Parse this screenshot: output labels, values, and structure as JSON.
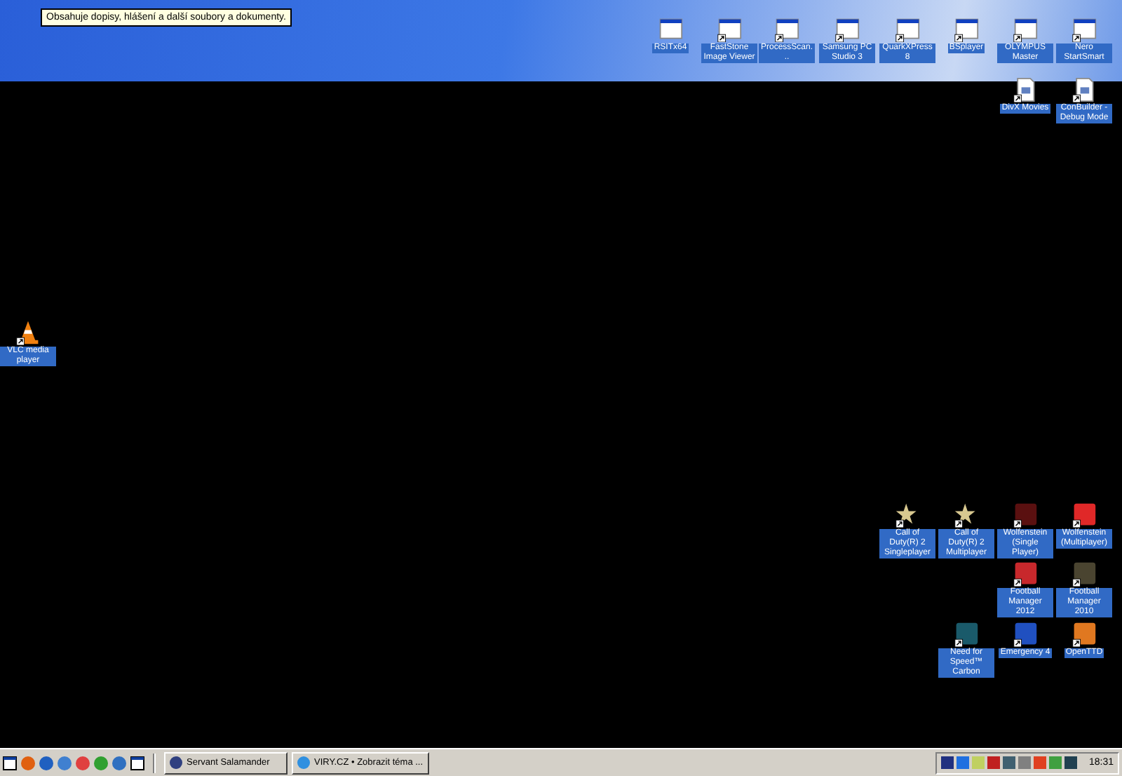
{
  "tooltip": {
    "text": "Obsahuje dopisy, hlášení a další soubory a dokumenty."
  },
  "desktop_icons": [
    {
      "label": "RSITx64",
      "kind": "window",
      "shortcut": false
    },
    {
      "label": "FastStone Image Viewer",
      "kind": "window",
      "shortcut": true
    },
    {
      "label": "ProcessScan...",
      "kind": "window",
      "shortcut": true
    },
    {
      "label": "Samsung PC Studio 3",
      "kind": "window",
      "shortcut": true
    },
    {
      "label": "QuarkXPress 8",
      "kind": "window",
      "shortcut": true
    },
    {
      "label": "BSplayer",
      "kind": "window",
      "shortcut": true
    },
    {
      "label": "OLYMPUS Master",
      "kind": "window",
      "shortcut": true
    },
    {
      "label": "Nero StartSmart",
      "kind": "window",
      "shortcut": true
    },
    {
      "label": "DivX Movies",
      "kind": "document",
      "shortcut": true
    },
    {
      "label": "ConBuilder -Debug Mode",
      "kind": "document",
      "shortcut": true
    },
    {
      "label": "VLC media player",
      "kind": "cone",
      "shortcut": true
    },
    {
      "label": "Call of Duty(R) 2 Singleplayer",
      "kind": "star",
      "shortcut": true
    },
    {
      "label": "Call of Duty(R) 2 Multiplayer",
      "kind": "star",
      "shortcut": true
    },
    {
      "label": "Wolfenstein (Single Player)",
      "kind": "tile",
      "color": "#5a1010",
      "shortcut": true
    },
    {
      "label": "Wolfenstein (Multiplayer)",
      "kind": "tile",
      "color": "#e02828",
      "shortcut": true
    },
    {
      "label": "Football Manager 2012",
      "kind": "tile",
      "color": "#c8282c",
      "shortcut": true
    },
    {
      "label": "Football Manager 2010",
      "kind": "tile",
      "color": "#4a4430",
      "shortcut": true
    },
    {
      "label": "Need for Speed™ Carbon",
      "kind": "tile",
      "color": "#1a5a6a",
      "shortcut": true
    },
    {
      "label": "Emergency 4",
      "kind": "tile",
      "color": "#2050c0",
      "shortcut": true
    },
    {
      "label": "OpenTTD",
      "kind": "tile",
      "color": "#e07820",
      "shortcut": true
    }
  ],
  "taskbar": {
    "quick_launch": [
      {
        "kind": "window"
      },
      {
        "kind": "circle",
        "color": "#e06010"
      },
      {
        "kind": "circle",
        "color": "#2060c0"
      },
      {
        "kind": "circle",
        "color": "#4080d0"
      },
      {
        "kind": "circle",
        "color": "#e04040"
      },
      {
        "kind": "circle",
        "color": "#30a030"
      },
      {
        "kind": "circle",
        "color": "#3070c0"
      },
      {
        "kind": "window"
      }
    ],
    "tasks": [
      {
        "label": "Servant Salamander",
        "selected": false
      },
      {
        "label": "VIRY.CZ • Zobrazit téma ...",
        "selected": false
      }
    ],
    "tray": [
      {
        "color": "#203080"
      },
      {
        "color": "#2070e0"
      },
      {
        "color": "#c0d060"
      },
      {
        "color": "#c02020"
      },
      {
        "color": "#406070"
      },
      {
        "color": "#808080"
      },
      {
        "color": "#e04020"
      },
      {
        "color": "#40a040"
      },
      {
        "color": "#204050"
      }
    ],
    "clock": "18:31"
  }
}
